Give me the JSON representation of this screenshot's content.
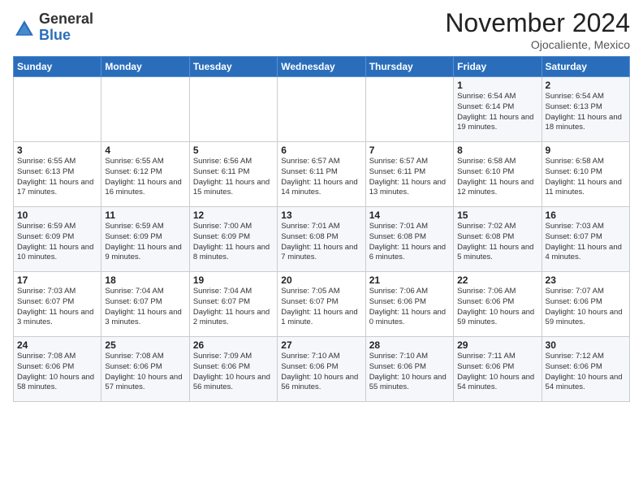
{
  "logo": {
    "general": "General",
    "blue": "Blue"
  },
  "title": "November 2024",
  "location": "Ojocaliente, Mexico",
  "days_header": [
    "Sunday",
    "Monday",
    "Tuesday",
    "Wednesday",
    "Thursday",
    "Friday",
    "Saturday"
  ],
  "weeks": [
    [
      {
        "day": "",
        "info": ""
      },
      {
        "day": "",
        "info": ""
      },
      {
        "day": "",
        "info": ""
      },
      {
        "day": "",
        "info": ""
      },
      {
        "day": "",
        "info": ""
      },
      {
        "day": "1",
        "info": "Sunrise: 6:54 AM\nSunset: 6:14 PM\nDaylight: 11 hours and 19 minutes."
      },
      {
        "day": "2",
        "info": "Sunrise: 6:54 AM\nSunset: 6:13 PM\nDaylight: 11 hours and 18 minutes."
      }
    ],
    [
      {
        "day": "3",
        "info": "Sunrise: 6:55 AM\nSunset: 6:13 PM\nDaylight: 11 hours and 17 minutes."
      },
      {
        "day": "4",
        "info": "Sunrise: 6:55 AM\nSunset: 6:12 PM\nDaylight: 11 hours and 16 minutes."
      },
      {
        "day": "5",
        "info": "Sunrise: 6:56 AM\nSunset: 6:11 PM\nDaylight: 11 hours and 15 minutes."
      },
      {
        "day": "6",
        "info": "Sunrise: 6:57 AM\nSunset: 6:11 PM\nDaylight: 11 hours and 14 minutes."
      },
      {
        "day": "7",
        "info": "Sunrise: 6:57 AM\nSunset: 6:11 PM\nDaylight: 11 hours and 13 minutes."
      },
      {
        "day": "8",
        "info": "Sunrise: 6:58 AM\nSunset: 6:10 PM\nDaylight: 11 hours and 12 minutes."
      },
      {
        "day": "9",
        "info": "Sunrise: 6:58 AM\nSunset: 6:10 PM\nDaylight: 11 hours and 11 minutes."
      }
    ],
    [
      {
        "day": "10",
        "info": "Sunrise: 6:59 AM\nSunset: 6:09 PM\nDaylight: 11 hours and 10 minutes."
      },
      {
        "day": "11",
        "info": "Sunrise: 6:59 AM\nSunset: 6:09 PM\nDaylight: 11 hours and 9 minutes."
      },
      {
        "day": "12",
        "info": "Sunrise: 7:00 AM\nSunset: 6:09 PM\nDaylight: 11 hours and 8 minutes."
      },
      {
        "day": "13",
        "info": "Sunrise: 7:01 AM\nSunset: 6:08 PM\nDaylight: 11 hours and 7 minutes."
      },
      {
        "day": "14",
        "info": "Sunrise: 7:01 AM\nSunset: 6:08 PM\nDaylight: 11 hours and 6 minutes."
      },
      {
        "day": "15",
        "info": "Sunrise: 7:02 AM\nSunset: 6:08 PM\nDaylight: 11 hours and 5 minutes."
      },
      {
        "day": "16",
        "info": "Sunrise: 7:03 AM\nSunset: 6:07 PM\nDaylight: 11 hours and 4 minutes."
      }
    ],
    [
      {
        "day": "17",
        "info": "Sunrise: 7:03 AM\nSunset: 6:07 PM\nDaylight: 11 hours and 3 minutes."
      },
      {
        "day": "18",
        "info": "Sunrise: 7:04 AM\nSunset: 6:07 PM\nDaylight: 11 hours and 3 minutes."
      },
      {
        "day": "19",
        "info": "Sunrise: 7:04 AM\nSunset: 6:07 PM\nDaylight: 11 hours and 2 minutes."
      },
      {
        "day": "20",
        "info": "Sunrise: 7:05 AM\nSunset: 6:07 PM\nDaylight: 11 hours and 1 minute."
      },
      {
        "day": "21",
        "info": "Sunrise: 7:06 AM\nSunset: 6:06 PM\nDaylight: 11 hours and 0 minutes."
      },
      {
        "day": "22",
        "info": "Sunrise: 7:06 AM\nSunset: 6:06 PM\nDaylight: 10 hours and 59 minutes."
      },
      {
        "day": "23",
        "info": "Sunrise: 7:07 AM\nSunset: 6:06 PM\nDaylight: 10 hours and 59 minutes."
      }
    ],
    [
      {
        "day": "24",
        "info": "Sunrise: 7:08 AM\nSunset: 6:06 PM\nDaylight: 10 hours and 58 minutes."
      },
      {
        "day": "25",
        "info": "Sunrise: 7:08 AM\nSunset: 6:06 PM\nDaylight: 10 hours and 57 minutes."
      },
      {
        "day": "26",
        "info": "Sunrise: 7:09 AM\nSunset: 6:06 PM\nDaylight: 10 hours and 56 minutes."
      },
      {
        "day": "27",
        "info": "Sunrise: 7:10 AM\nSunset: 6:06 PM\nDaylight: 10 hours and 56 minutes."
      },
      {
        "day": "28",
        "info": "Sunrise: 7:10 AM\nSunset: 6:06 PM\nDaylight: 10 hours and 55 minutes."
      },
      {
        "day": "29",
        "info": "Sunrise: 7:11 AM\nSunset: 6:06 PM\nDaylight: 10 hours and 54 minutes."
      },
      {
        "day": "30",
        "info": "Sunrise: 7:12 AM\nSunset: 6:06 PM\nDaylight: 10 hours and 54 minutes."
      }
    ]
  ]
}
